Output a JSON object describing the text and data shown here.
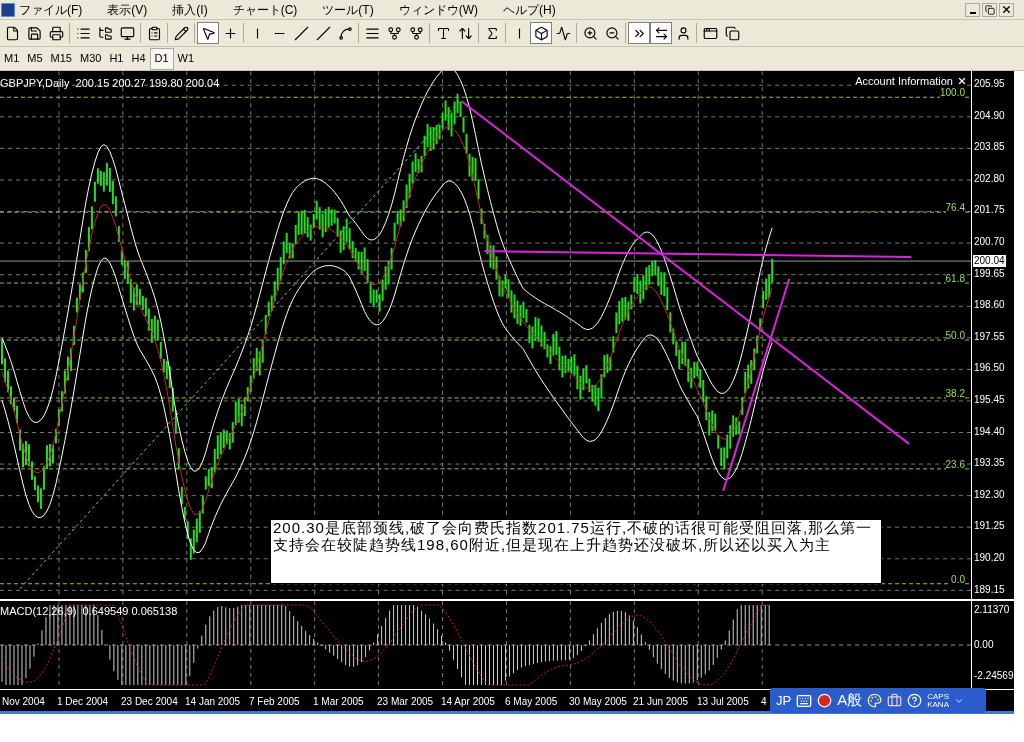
{
  "menu": [
    "ファイル(F)",
    "表示(V)",
    "挿入(I)",
    "チャート(C)",
    "ツール(T)",
    "ウィンドウ(W)",
    "ヘルプ(H)"
  ],
  "toolbar": [
    [
      {
        "kind": "new",
        "pressed": false
      },
      {
        "kind": "save",
        "pressed": false
      },
      {
        "kind": "print",
        "pressed": false
      }
    ],
    [
      {
        "kind": "market-watch",
        "pressed": false
      },
      {
        "kind": "navigator",
        "pressed": false
      },
      {
        "kind": "terminal",
        "pressed": false
      }
    ],
    [
      {
        "kind": "properties",
        "pressed": false
      }
    ],
    [
      {
        "kind": "expert",
        "pressed": false
      }
    ],
    [
      {
        "kind": "cursor",
        "pressed": true
      },
      {
        "kind": "crosshair",
        "pressed": false
      }
    ],
    [
      {
        "kind": "vline",
        "pressed": false
      },
      {
        "kind": "hline",
        "pressed": false
      },
      {
        "kind": "trendline",
        "pressed": false
      },
      {
        "kind": "channel",
        "pressed": false
      },
      {
        "kind": "fan",
        "pressed": false
      }
    ],
    [
      {
        "kind": "fibo",
        "pressed": false
      },
      {
        "kind": "pitchfork",
        "pressed": false
      },
      {
        "kind": "fork",
        "pressed": false
      }
    ],
    [
      {
        "kind": "text",
        "pressed": false
      },
      {
        "kind": "arrows",
        "pressed": false
      }
    ],
    [
      {
        "kind": "indicator",
        "pressed": false
      }
    ],
    [
      {
        "kind": "bars",
        "pressed": false
      },
      {
        "kind": "candles",
        "pressed": true
      },
      {
        "kind": "line",
        "pressed": false
      }
    ],
    [
      {
        "kind": "zoom-in",
        "pressed": false
      },
      {
        "kind": "zoom-out",
        "pressed": false
      }
    ],
    [
      {
        "kind": "autoscroll",
        "pressed": true
      },
      {
        "kind": "shift",
        "pressed": true
      },
      {
        "kind": "template",
        "pressed": false
      }
    ],
    [
      {
        "kind": "window",
        "pressed": false
      },
      {
        "kind": "windows",
        "pressed": false
      }
    ]
  ],
  "timeframes": [
    {
      "label": "M1",
      "selected": false
    },
    {
      "label": "M5",
      "selected": false
    },
    {
      "label": "M15",
      "selected": false
    },
    {
      "label": "M30",
      "selected": false
    },
    {
      "label": "H1",
      "selected": false
    },
    {
      "label": "H4",
      "selected": false
    },
    {
      "label": "D1",
      "selected": true
    },
    {
      "label": "W1",
      "selected": false
    }
  ],
  "chart": {
    "header": "GBPJPY,Daily  200.15 200.27 199.80 200.04",
    "account_panel": "Account Information",
    "price_ticks": [
      "205.95",
      "204.90",
      "203.85",
      "202.80",
      "201.75",
      "200.70",
      "199.65",
      "198.60",
      "197.55",
      "196.50",
      "195.45",
      "194.40",
      "193.35",
      "192.30",
      "191.25",
      "190.20",
      "189.15"
    ],
    "current_price": "200.04",
    "fib_levels": [
      "100.0",
      "76.4",
      "61.8",
      "50.0",
      "38.2",
      "23.6",
      "0.0"
    ],
    "note": "200.30是底部颈线,破了会向费氏指数201.75运行,不破的话很可能受阻回落,那么第一支持会在较陡趋势线198,60附近,但是现在上升趋势还没破坏,所以还以买入为主"
  },
  "macd": {
    "header": "MACD(12,26,9)  0.649549 0.065138",
    "ticks": [
      "2.11370",
      "0.00",
      "-2.24569"
    ]
  },
  "dates": [
    "Nov 2004",
    "1 Dec 2004",
    "23 Dec 2004",
    "14 Jan 2005",
    "7 Feb 2005",
    "1 Mar 2005",
    "23 Mar 2005",
    "14 Apr 2005",
    "6 May 2005",
    "30 May 2005",
    "21 Jun 2005",
    "13 Jul 2005",
    "4"
  ],
  "ime": {
    "language": "JP",
    "mode": "A般",
    "caps": "CAPS",
    "kana": "KANA"
  }
}
